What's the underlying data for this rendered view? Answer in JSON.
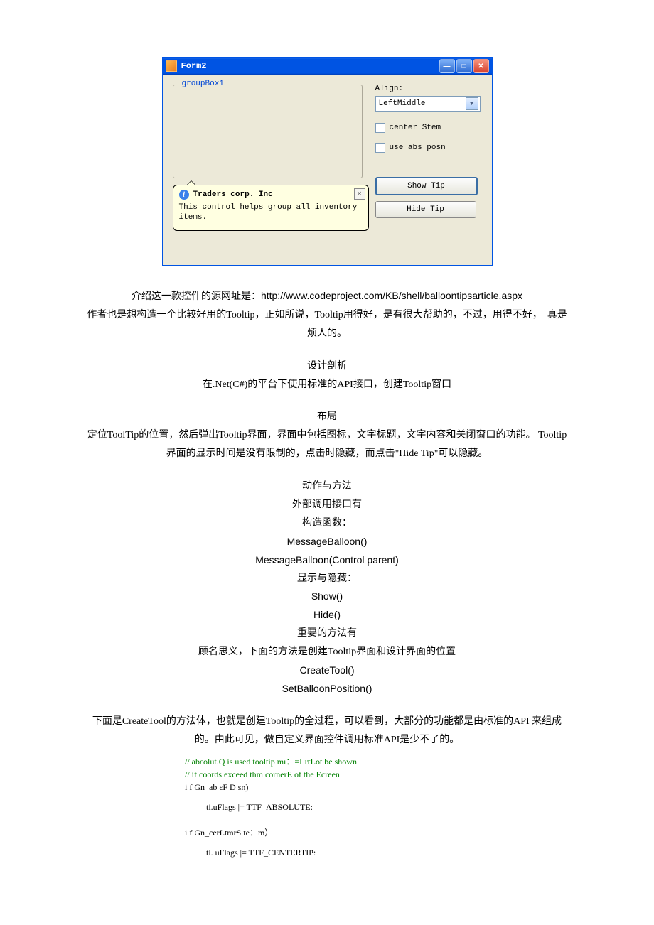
{
  "form": {
    "title": "Form2",
    "groupbox_title": "groupBox1",
    "balloon": {
      "title": "Traders corp. Inc",
      "body": "This control helps group all inventory items."
    },
    "align_label": "Align:",
    "align_value": "LeftMiddle",
    "center_stem": "center Stem",
    "use_abs": "use abs posn",
    "show_tip": "Show Tip",
    "hide_tip": "Hide Tip"
  },
  "article": {
    "p1a": "介绍这一款控件的源网址是：",
    "p1b": "http://www.codeproject.com/KB/shell/balloontipsarticle.aspx",
    "p2": "作者也是想构造一个比较好用的Tooltip，正如所说，Tooltip用得好，是有很大帮助的，不过，用得不好，　真是烦人的。",
    "h1": "设计剖析",
    "p3": "在.Net(C#)的平台下使用标准的API接口，创建Tooltip窗口",
    "h2": "布局",
    "p4": "定位ToolTip的位置，然后弹出Tooltip界面，界面中包括图标，文字标题，文字内容和关闭窗口的功能。 Tooltip界面的显示时间是没有限制的，点击时隐藏，而点击\"Hide Tip\"可以隐藏。",
    "h3": "动作与方法",
    "p5": "外部调用接口有",
    "p6": "构造函数：",
    "code1": "MessageBalloon()",
    "code2": "MessageBalloon(Control parent)",
    "p7": "显示与隐藏：",
    "code3": "Show()",
    "code4": "Hide()",
    "p8": "重要的方法有",
    "p9": "顾名思义，下面的方法是创建Tooltip界面和设计界面的位置",
    "code5": "CreateTool()",
    "code6": "SetBalloonPosition()",
    "p10": "下面是CreateTool的方法体，也就是创建Tooltip的全过程，可以看到，大部分的功能都是由标准的API 来组成的。由此可见，做自定义界面控件调用标准API是少不了的。",
    "codeblock": {
      "c1": "// abεolut.Q is used tooltip mı：=LıτLot be shown",
      "c2": "// if coords exceed thm cornerE of the Ecreen",
      "l1": "i f Gn_ab εF D sn)",
      "l2": "ti.uFlags |= TTF_ABSOLUTE:",
      "l3": "i f Gn_cerLtmrS te：m）",
      "l4": "ti. uFlags |= TTF_CENTERTIP:"
    }
  }
}
